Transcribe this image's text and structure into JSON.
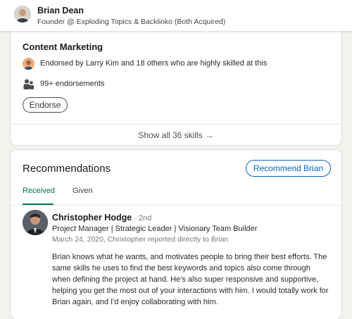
{
  "topbar": {
    "name": "Brian Dean",
    "headline": "Founder @ Exploding Topics & Backlinko (Both Acquired)"
  },
  "skills": {
    "skill_name": "Content Marketing",
    "endorsed_by": "Endorsed by Larry Kim and 18 others who are highly skilled at this",
    "endorsement_count": "99+ endorsements",
    "endorse_label": "Endorse",
    "show_all": "Show all 36 skills",
    "show_all_arrow": "→"
  },
  "recommendations": {
    "title": "Recommendations",
    "recommend_label": "Recommend Brian",
    "tabs": [
      {
        "label": "Received",
        "active": true
      },
      {
        "label": "Given",
        "active": false
      }
    ],
    "item": {
      "name": "Christopher Hodge",
      "degree": "· 2nd",
      "headline": "Project Manager | Strategic Leader | Visionary Team Builder",
      "meta": "March 24, 2020, Christopher reported directly to Brian",
      "text": "Brian knows what he wants, and motivates people to bring their best efforts. The same skills he uses to find the best keywords and topics also come through when defining the project at hand. He's also super responsive and supportive, helping you get the most out of your interactions with him. I would totally work for Brian again, and I'd enjoy collaborating with him."
    }
  },
  "colors": {
    "accent_blue": "#0a66c2",
    "accent_green": "#01754f",
    "background": "#f4f2ee"
  },
  "icons": [
    "avatar",
    "people-icon",
    "arrow-right-icon"
  ]
}
